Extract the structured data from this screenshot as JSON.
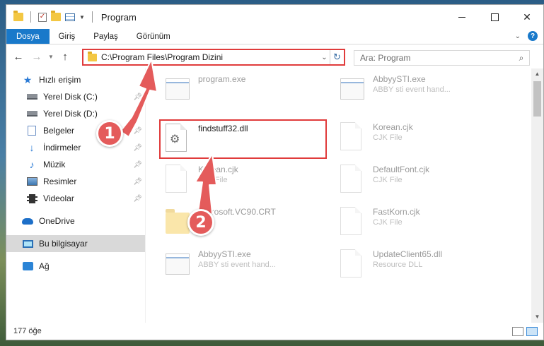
{
  "window": {
    "title": "Program",
    "controls": {
      "minimize": "–",
      "maximize": "□",
      "close": "✕"
    }
  },
  "ribbon": {
    "tabs": [
      {
        "label": "Dosya",
        "active": true
      },
      {
        "label": "Giriş"
      },
      {
        "label": "Paylaş"
      },
      {
        "label": "Görünüm"
      }
    ],
    "help": "?"
  },
  "navigation": {
    "back": "←",
    "forward": "→",
    "up": "↑",
    "address": "C:\\Program Files\\Program Dizini",
    "search_placeholder": "Ara: Program"
  },
  "sidebar": {
    "items": [
      {
        "label": "Hızlı erişim",
        "icon": "star-icon"
      },
      {
        "label": "Yerel Disk (C:)",
        "icon": "drive-icon",
        "pinned": true
      },
      {
        "label": "Yerel Disk (D:)",
        "icon": "drive-icon",
        "pinned": true
      },
      {
        "label": "Belgeler",
        "icon": "documents-icon",
        "pinned": true
      },
      {
        "label": "İndirmeler",
        "icon": "downloads-icon",
        "pinned": true
      },
      {
        "label": "Müzik",
        "icon": "music-icon",
        "pinned": true
      },
      {
        "label": "Resimler",
        "icon": "pictures-icon",
        "pinned": true
      },
      {
        "label": "Videolar",
        "icon": "videos-icon",
        "pinned": true
      },
      {
        "label": "OneDrive",
        "icon": "cloud-icon"
      },
      {
        "label": "Bu bilgisayar",
        "icon": "computer-icon",
        "selected": true
      },
      {
        "label": "Ağ",
        "icon": "network-icon"
      }
    ]
  },
  "files": [
    {
      "name": "program.exe",
      "type": "",
      "icon": "exe-icon",
      "faded": true
    },
    {
      "name": "AbbyySTI.exe",
      "type": "ABBY sti event hand...",
      "icon": "exe-icon",
      "faded": true
    },
    {
      "name": "findstuff32.dll",
      "type": "",
      "icon": "dll-gear-icon",
      "highlighted": true
    },
    {
      "name": "Korean.cjk",
      "type": "CJK File",
      "icon": "file-icon",
      "faded": true
    },
    {
      "name": "Korean.cjk",
      "type": "CJK File",
      "icon": "file-icon",
      "faded": true
    },
    {
      "name": "DefaultFont.cjk",
      "type": "CJK File",
      "icon": "file-icon",
      "faded": true
    },
    {
      "name": "Microsoft.VC90.CRT",
      "type": "",
      "icon": "folder-icon",
      "faded": true
    },
    {
      "name": "FastKorn.cjk",
      "type": "CJK File",
      "icon": "file-icon",
      "faded": true
    },
    {
      "name": "AbbyySTI.exe",
      "type": "ABBY sti event hand...",
      "icon": "exe-icon",
      "faded": true
    },
    {
      "name": "UpdateClient65.dll",
      "type": "Resource DLL",
      "icon": "dll-icon",
      "faded": true
    }
  ],
  "status": {
    "count": "177 öğe"
  },
  "callouts": [
    {
      "number": "1",
      "target": "address-bar"
    },
    {
      "number": "2",
      "target": "findstuff32-dll"
    }
  ],
  "colors": {
    "accent": "#1979ca",
    "highlight": "#e03b3b",
    "badge": "#e45b5b"
  }
}
